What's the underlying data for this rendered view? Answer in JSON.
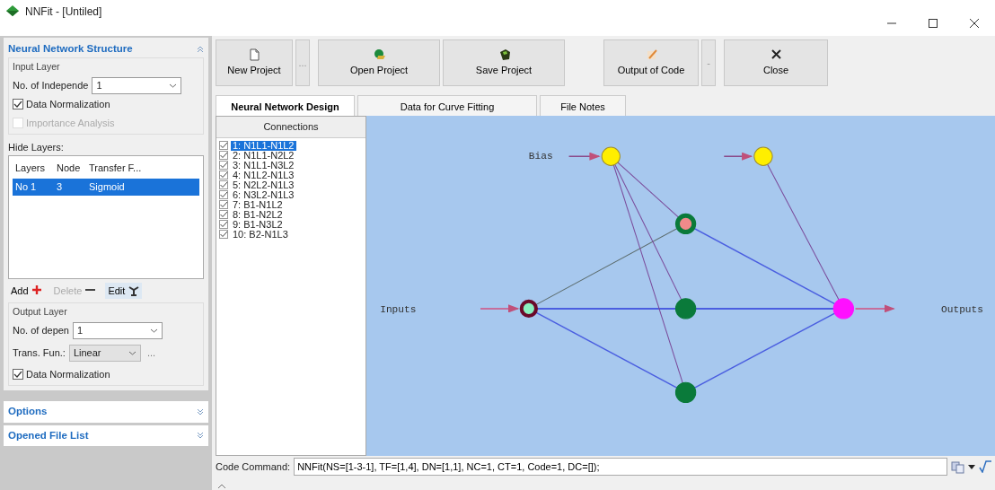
{
  "window": {
    "title": "NNFit - [Untiled]"
  },
  "structure_panel": {
    "title": "Neural Network Structure",
    "expanded": true,
    "input_layer": {
      "title": "Input Layer",
      "count_label": "No. of Independe",
      "count_value": "1",
      "normalization": {
        "label": "Data Normalization",
        "checked": true
      },
      "importance": {
        "label": "Importance Analysis",
        "checked": false,
        "disabled": true
      }
    },
    "hide_layers": {
      "label": "Hide Layers:",
      "columns": [
        "Layers",
        "Node",
        "Transfer F..."
      ],
      "rows": [
        {
          "cells": [
            "No 1",
            "3",
            "Sigmoid"
          ],
          "selected": true
        }
      ]
    },
    "actions": [
      {
        "label": "Add",
        "kind": "add",
        "disabled": false
      },
      {
        "label": "Delete",
        "kind": "delete",
        "disabled": true
      },
      {
        "label": "Edit",
        "kind": "edit",
        "disabled": false
      }
    ],
    "output_layer": {
      "title": "Output Layer",
      "count_label": "No. of depen",
      "count_value": "1",
      "trans_label": "Trans. Fun.:",
      "trans_value": "Linear",
      "more": "...",
      "normalization": {
        "label": "Data Normalization",
        "checked": true
      }
    }
  },
  "collapsed_panels": [
    {
      "title": "Options",
      "expanded": false
    },
    {
      "title": "Opened File List",
      "expanded": false
    }
  ],
  "toolbar": [
    {
      "label": "New Project",
      "kind": "new"
    },
    {
      "label": "...",
      "kind": "more"
    },
    {
      "label": "Open Project",
      "kind": "open"
    },
    {
      "label": "Save Project",
      "kind": "save"
    },
    {
      "label": "Output of Code",
      "kind": "code"
    },
    {
      "label": "-",
      "kind": "more"
    },
    {
      "label": "Close",
      "kind": "close"
    }
  ],
  "tabs": [
    {
      "label": "Neural Network Design",
      "selected": true
    },
    {
      "label": "Data for Curve Fitting",
      "selected": false
    },
    {
      "label": "File Notes",
      "selected": false
    }
  ],
  "connections": {
    "header": "Connections",
    "items": [
      {
        "label": "1: N1L1-N1L2",
        "checked": true,
        "selected": true
      },
      {
        "label": "2: N1L1-N2L2",
        "checked": true,
        "selected": false
      },
      {
        "label": "3: N1L1-N3L2",
        "checked": true,
        "selected": false
      },
      {
        "label": "4: N1L2-N1L3",
        "checked": true,
        "selected": false
      },
      {
        "label": "5: N2L2-N1L3",
        "checked": true,
        "selected": false
      },
      {
        "label": "6: N3L2-N1L3",
        "checked": true,
        "selected": false
      },
      {
        "label": "7: B1-N1L2",
        "checked": true,
        "selected": false
      },
      {
        "label": "8: B1-N2L2",
        "checked": true,
        "selected": false
      },
      {
        "label": "9: B1-N3L2",
        "checked": true,
        "selected": false
      },
      {
        "label": "10: B2-N1L3",
        "checked": true,
        "selected": false
      }
    ]
  },
  "diagram": {
    "bias_label": "Bias",
    "inputs_label": "Inputs",
    "outputs_label": "Outputs"
  },
  "code_command": {
    "label": "Code Command:",
    "value": "NNFit(NS=[1-3-1], TF=[1,4], DN=[1,1], NC=1, CT=1, Code=1, DC=[]);"
  }
}
